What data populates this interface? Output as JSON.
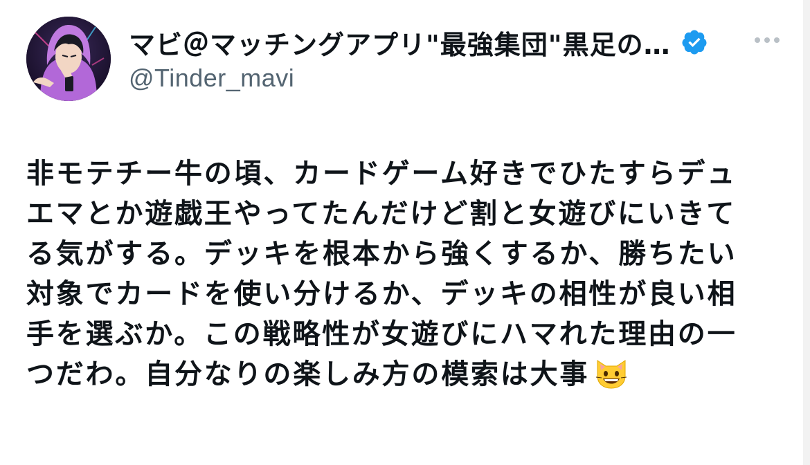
{
  "author": {
    "display_name": "マビ＠マッチングアプリ\"最強集団\"黒足の…",
    "handle": "@Tinder_mavi",
    "verified": true
  },
  "tweet": {
    "lines": [
      "非モテチー牛の頃、カードゲーム好きでひたすらデュ",
      "エマとか遊戯王やってたんだけど割と女遊びにいきて",
      "る気がする。デッキを根本から強くするか、勝ちたい",
      "対象でカードを使い分けるか、デッキの相性が良い相",
      "手を選ぶか。この戦略性が女遊びにハマれた理由の一",
      "つだわ。自分なりの楽しみ方の模索は大事"
    ],
    "emoji": "grinning-cat-emoji"
  },
  "icons": {
    "verified": "verified-badge-icon",
    "more": "more-options-icon"
  },
  "colors": {
    "text": "#0f1419",
    "secondary": "#536471",
    "verified_blue": "#1d9bf0",
    "avatar_hoodie": "#b268d8"
  }
}
